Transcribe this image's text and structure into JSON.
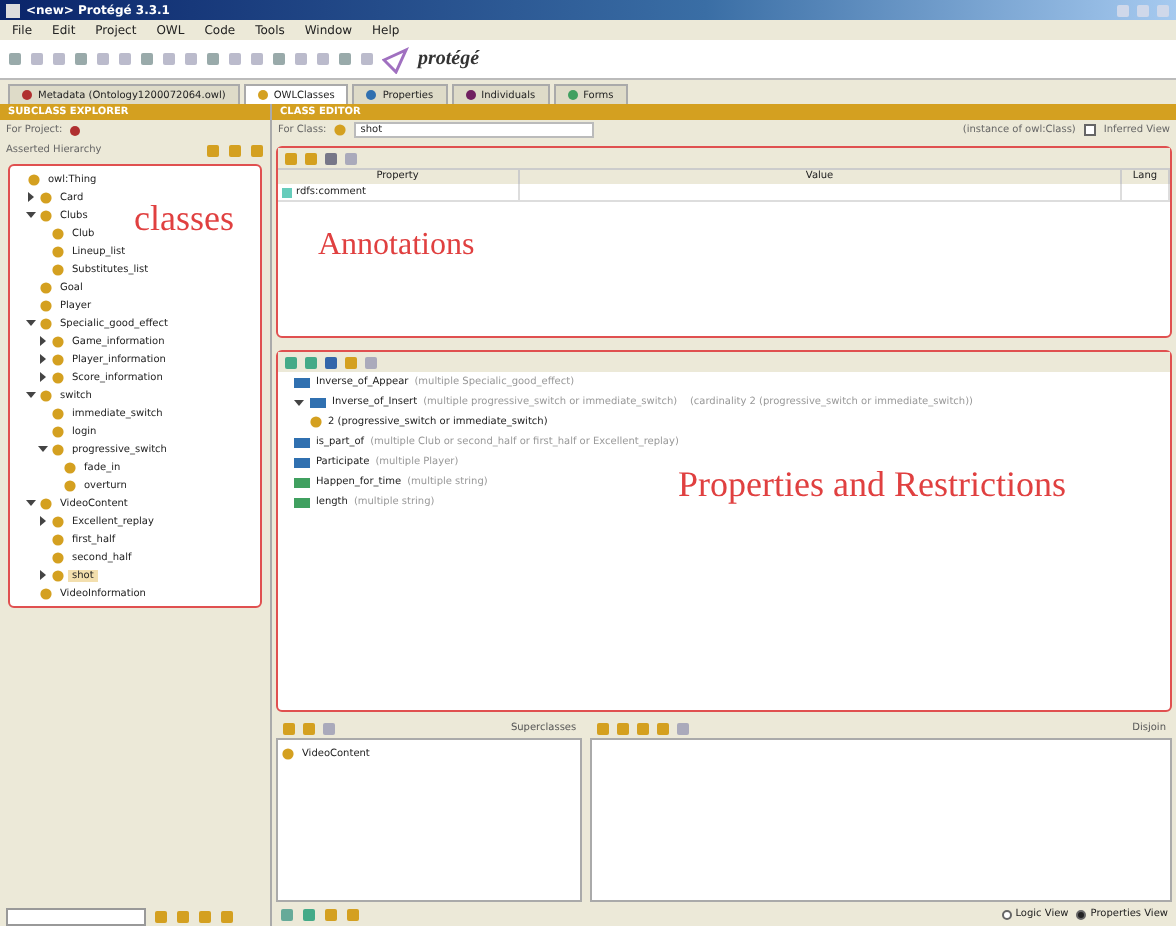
{
  "window": {
    "title": "<new>  Protégé 3.3.1"
  },
  "menu": [
    "File",
    "Edit",
    "Project",
    "OWL",
    "Code",
    "Tools",
    "Window",
    "Help"
  ],
  "logo": "protégé",
  "tabs": [
    {
      "label": "Metadata (Ontology1200072064.owl)",
      "selected": false,
      "color": "#b03030"
    },
    {
      "label": "OWLClasses",
      "selected": true,
      "color": "#d4a020"
    },
    {
      "label": "Properties",
      "selected": false,
      "color": "#3070b0"
    },
    {
      "label": "Individuals",
      "selected": false,
      "color": "#702060"
    },
    {
      "label": "Forms",
      "selected": false,
      "color": "#40a060"
    }
  ],
  "subclass_explorer": {
    "header": "SUBCLASS EXPLORER",
    "for_project": "For Project:",
    "hierarchy_label": "Asserted Hierarchy",
    "tree": [
      {
        "label": "owl:Thing",
        "selected": false,
        "children": [
          {
            "label": "Card",
            "selected": false,
            "expanded": false
          },
          {
            "label": "Clubs",
            "selected": false,
            "expanded": true,
            "children": [
              {
                "label": "Club",
                "selected": false
              },
              {
                "label": "Lineup_list",
                "selected": false
              },
              {
                "label": "Substitutes_list",
                "selected": false
              }
            ]
          },
          {
            "label": "Goal",
            "selected": false
          },
          {
            "label": "Player",
            "selected": false
          },
          {
            "label": "Specialic_good_effect",
            "selected": false,
            "expanded": true,
            "children": [
              {
                "label": "Game_information",
                "selected": false,
                "expanded": false
              },
              {
                "label": "Player_information",
                "selected": false,
                "expanded": false
              },
              {
                "label": "Score_information",
                "selected": false,
                "expanded": false
              }
            ]
          },
          {
            "label": "switch",
            "selected": false,
            "expanded": true,
            "children": [
              {
                "label": "immediate_switch",
                "selected": false
              },
              {
                "label": "login",
                "selected": false
              },
              {
                "label": "progressive_switch",
                "selected": false,
                "expanded": true,
                "children": [
                  {
                    "label": "fade_in",
                    "selected": false
                  },
                  {
                    "label": "overturn",
                    "selected": false
                  }
                ]
              }
            ]
          },
          {
            "label": "VideoContent",
            "selected": false,
            "expanded": true,
            "children": [
              {
                "label": "Excellent_replay",
                "selected": false,
                "expanded": false
              },
              {
                "label": "first_half",
                "selected": false
              },
              {
                "label": "second_half",
                "selected": false
              },
              {
                "label": "shot",
                "selected": true,
                "expanded": false
              }
            ]
          },
          {
            "label": "VideoInformation",
            "selected": false
          }
        ]
      }
    ]
  },
  "class_editor": {
    "header": "CLASS EDITOR",
    "for_class": "For Class:",
    "class_name": "shot",
    "instance_of": "(instance of owl:Class)",
    "inferred_view": {
      "label": "Inferred View",
      "checked": false
    },
    "annotations": {
      "columns": [
        "Property",
        "Value",
        "Lang"
      ],
      "rows": [
        {
          "property": "rdfs:comment"
        }
      ]
    },
    "properties": {
      "items": [
        {
          "kind": "object",
          "name": "Inverse_of_Appear",
          "detail": "(multiple Specialic_good_effect)"
        },
        {
          "kind": "object",
          "name": "Inverse_of_Insert",
          "detail": "(multiple progressive_switch or immediate_switch)    (cardinality 2 (progressive_switch or immediate_switch))",
          "expanded": true,
          "children": [
            {
              "kind": "restriction",
              "name": "2 (progressive_switch or immediate_switch)"
            }
          ]
        },
        {
          "kind": "object",
          "name": "is_part_of",
          "detail": "(multiple Club or second_half or first_half or Excellent_replay)"
        },
        {
          "kind": "object",
          "name": "Participate",
          "detail": "(multiple Player)"
        },
        {
          "kind": "datatype",
          "name": "Happen_for_time",
          "detail": "(multiple string)"
        },
        {
          "kind": "datatype",
          "name": "length",
          "detail": "(multiple string)"
        }
      ]
    },
    "superclasses": {
      "title": "Superclasses",
      "items": [
        "VideoContent"
      ]
    },
    "disjoints": {
      "title": "Disjoin"
    }
  },
  "overlays": [
    "classes",
    "Annotations",
    "Properties and Restrictions"
  ],
  "status_bar": {
    "views": [
      {
        "label": "Logic View",
        "selected": false
      },
      {
        "label": "Properties View",
        "selected": true
      }
    ]
  }
}
